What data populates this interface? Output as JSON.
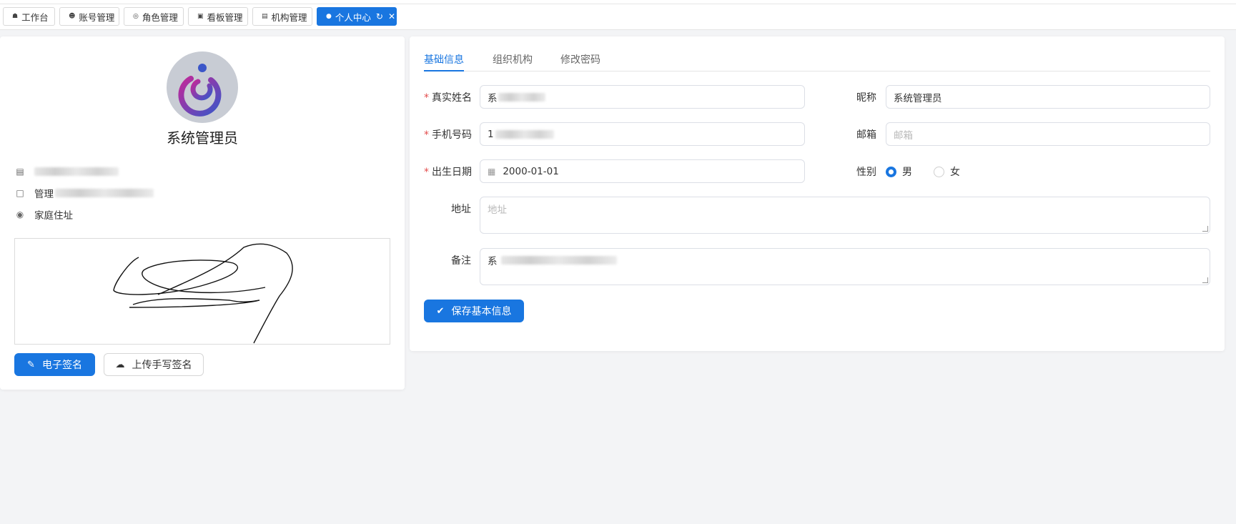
{
  "tabs": [
    {
      "label": "工作台",
      "icon": "home-icon"
    },
    {
      "label": "账号管理",
      "icon": "user-icon"
    },
    {
      "label": "角色管理",
      "icon": "role-icon"
    },
    {
      "label": "看板管理",
      "icon": "dashboard-icon"
    },
    {
      "label": "机构管理",
      "icon": "org-icon"
    },
    {
      "label": "个人中心",
      "icon": "dot-icon",
      "active": true
    }
  ],
  "profile": {
    "name": "系统管理员",
    "info_prefix_2": "管理",
    "address": "家庭住址"
  },
  "buttons": {
    "e_sign": "电子签名",
    "upload_sign": "上传手写签名",
    "save_basic": "保存基本信息"
  },
  "panel_tabs": [
    "基础信息",
    "组织机构",
    "修改密码"
  ],
  "form": {
    "real_name_label": "真实姓名",
    "real_name_value": "系",
    "nickname_label": "昵称",
    "nickname_value": "系统管理员",
    "phone_label": "手机号码",
    "phone_value": "1",
    "email_label": "邮箱",
    "email_placeholder": "邮箱",
    "birth_label": "出生日期",
    "birth_value": "2000-01-01",
    "gender_label": "性别",
    "gender_male": "男",
    "gender_female": "女",
    "gender_selected": "男",
    "address_label": "地址",
    "address_placeholder": "地址",
    "remark_label": "备注",
    "remark_value": "系"
  },
  "colors": {
    "primary": "#1976e0",
    "required": "#e34d4d",
    "background": "#f3f4f6"
  }
}
